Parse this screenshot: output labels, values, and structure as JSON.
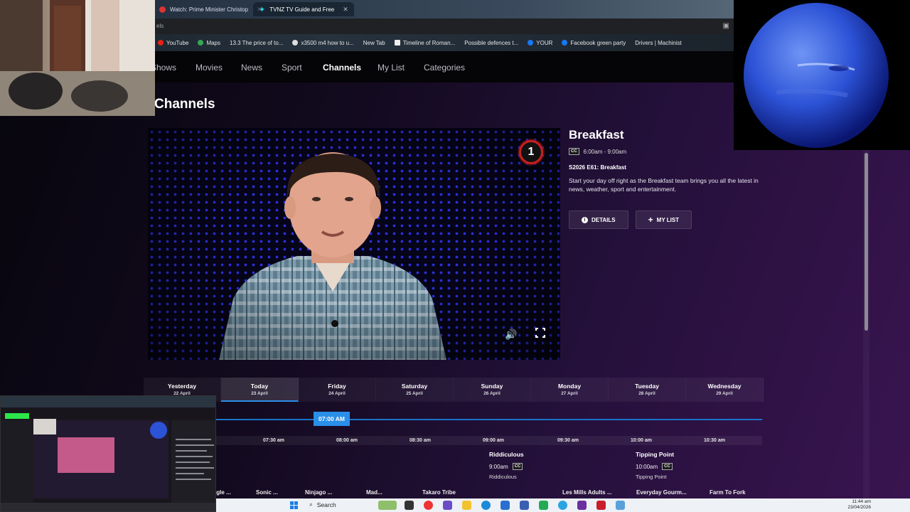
{
  "browser": {
    "tabs": [
      {
        "label": "Watch: Prime Minister Christop",
        "close": "✕"
      },
      {
        "label": "TVNZ TV Guide and Free",
        "close": "✕"
      }
    ],
    "url_fragment": "els",
    "bookmarks": [
      "YouTube",
      "Maps",
      "13.3 The price of to...",
      "x3500 m4 how to u...",
      "New Tab",
      "Timeline of Roman...",
      "Possible defences t...",
      "YOUR",
      "Facebook green party",
      "Drivers | Machinist"
    ]
  },
  "nav": {
    "items": [
      "Shows",
      "Movies",
      "News",
      "Sport",
      "Channels",
      "My List",
      "Categories"
    ],
    "active": "Channels"
  },
  "page_title": "Channels",
  "player": {
    "channel_logo": "1"
  },
  "programme": {
    "title": "Breakfast",
    "cc": "CC",
    "time": "6:00am - 9:00am",
    "episode": "S2026 E61: Breakfast",
    "description": "Start your day off right as the Breakfast team brings you all the latest in news, weather, sport and entertainment.",
    "details_label": "DETAILS",
    "mylist_label": "MY LIST"
  },
  "days": [
    {
      "name": "Yesterday",
      "date": "22 April"
    },
    {
      "name": "Today",
      "date": "23 April",
      "active": true
    },
    {
      "name": "Friday",
      "date": "24 April"
    },
    {
      "name": "Saturday",
      "date": "25 April"
    },
    {
      "name": "Sunday",
      "date": "26 April"
    },
    {
      "name": "Monday",
      "date": "27 April"
    },
    {
      "name": "Tuesday",
      "date": "28 April"
    },
    {
      "name": "Wednesday",
      "date": "29 April"
    }
  ],
  "guide": {
    "now": "07:00 AM",
    "time_labels": [
      "07:30 am",
      "08:00 am",
      "08:30 am",
      "09:00 am",
      "09:30 am",
      "10:00 am",
      "10:30 am"
    ],
    "programmes": [
      {
        "title": "Riddiculous",
        "time": "9:00am",
        "cc": "CC",
        "subtitle": "Riddiculous"
      },
      {
        "title": "Tipping Point",
        "time": "10:00am",
        "cc": "CC",
        "subtitle": "Tipping Point"
      }
    ],
    "row2": [
      "Jungle ...",
      "Sonic ...",
      "Ninjago ...",
      "Mad...",
      "Takaro Tribe",
      "Les Mills Adults ...",
      "Everyday Gourm...",
      "Farm To Fork"
    ]
  },
  "taskbar": {
    "search_placeholder": "Search",
    "time": "11:44 am",
    "date": "23/04/2026"
  },
  "colors": {
    "accent": "#2a8fe8",
    "channel_red": "#c8201d",
    "video_dots": "#2b31e0"
  }
}
